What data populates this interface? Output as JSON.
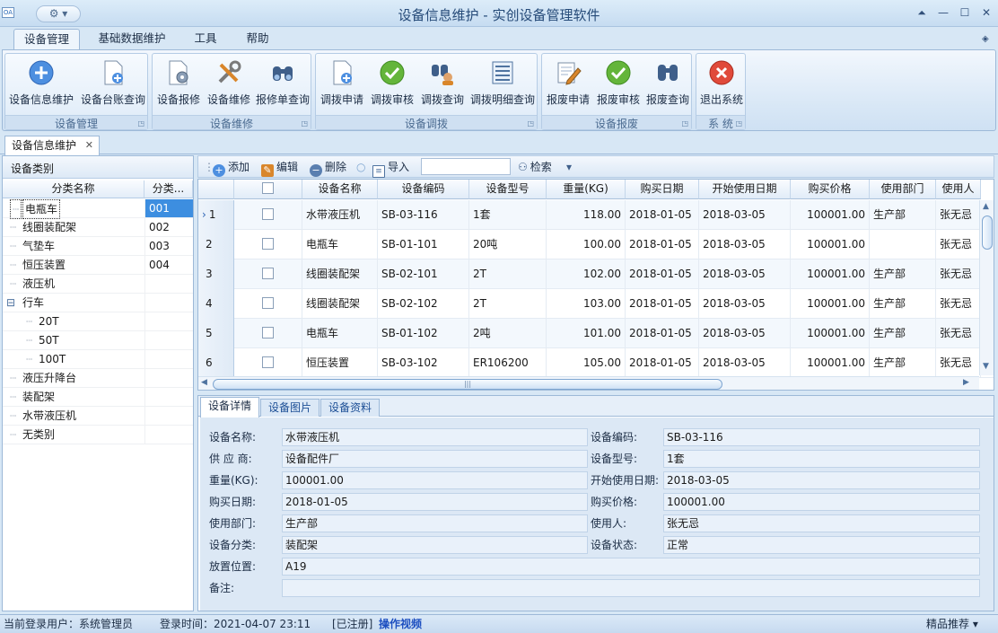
{
  "window": {
    "title": "设备信息维护 - 实创设备管理软件",
    "app_icon_text": "OA"
  },
  "ribbon_tabs": [
    "设备管理",
    "基础数据维护",
    "工具",
    "帮助"
  ],
  "ribbon_groups": [
    {
      "label": "设备管理",
      "buttons": [
        "设备信息维护",
        "设备台账查询"
      ]
    },
    {
      "label": "设备维修",
      "buttons": [
        "设备报修",
        "设备维修",
        "报修单查询"
      ]
    },
    {
      "label": "设备调拨",
      "buttons": [
        "调拨申请",
        "调拨审核",
        "调拨查询",
        "调拨明细查询"
      ]
    },
    {
      "label": "设备报废",
      "buttons": [
        "报废申请",
        "报废审核",
        "报废查询"
      ]
    },
    {
      "label": "系 统",
      "buttons": [
        "退出系统"
      ]
    }
  ],
  "doc_tab": {
    "label": "设备信息维护",
    "close": "✕"
  },
  "left_panel": {
    "title": "设备类别",
    "columns": [
      "分类名称",
      "分类..."
    ],
    "rows": [
      {
        "name": "电瓶车",
        "code": "001",
        "level": 0
      },
      {
        "name": "线圈装配架",
        "code": "002",
        "level": 0
      },
      {
        "name": "气垫车",
        "code": "003",
        "level": 0
      },
      {
        "name": "恒压装置",
        "code": "004",
        "level": 0
      },
      {
        "name": "液压机",
        "code": "",
        "level": 0
      },
      {
        "name": "行车",
        "code": "",
        "level": 0,
        "expander": "⊟"
      },
      {
        "name": "20T",
        "code": "",
        "level": 1
      },
      {
        "name": "50T",
        "code": "",
        "level": 1
      },
      {
        "name": "100T",
        "code": "",
        "level": 1
      },
      {
        "name": "液压升降台",
        "code": "",
        "level": 0
      },
      {
        "name": "装配架",
        "code": "",
        "level": 0
      },
      {
        "name": "水带液压机",
        "code": "",
        "level": 0
      },
      {
        "name": "无类别",
        "code": "",
        "level": 0
      }
    ]
  },
  "toolbar": {
    "add": "添加",
    "edit": "编辑",
    "delete": "删除",
    "import": "导入",
    "search_value": "",
    "search": "检索"
  },
  "grid": {
    "columns": [
      "",
      "",
      "设备名称",
      "设备编码",
      "设备型号",
      "重量(KG)",
      "购买日期",
      "开始使用日期",
      "购买价格",
      "使用部门",
      "使用人"
    ],
    "rows": [
      {
        "n": "1",
        "name": "水带液压机",
        "code": "SB-03-116",
        "model": "1套",
        "weight": "118.00",
        "buy": "2018-01-05",
        "start": "2018-03-05",
        "price": "100001.00",
        "dept": "生产部",
        "user": "张无忌"
      },
      {
        "n": "2",
        "name": "电瓶车",
        "code": "SB-01-101",
        "model": "20吨",
        "weight": "100.00",
        "buy": "2018-01-05",
        "start": "2018-03-05",
        "price": "100001.00",
        "dept": "",
        "user": "张无忌"
      },
      {
        "n": "3",
        "name": "线圈装配架",
        "code": "SB-02-101",
        "model": "2T",
        "weight": "102.00",
        "buy": "2018-01-05",
        "start": "2018-03-05",
        "price": "100001.00",
        "dept": "生产部",
        "user": "张无忌"
      },
      {
        "n": "4",
        "name": "线圈装配架",
        "code": "SB-02-102",
        "model": "2T",
        "weight": "103.00",
        "buy": "2018-01-05",
        "start": "2018-03-05",
        "price": "100001.00",
        "dept": "生产部",
        "user": "张无忌"
      },
      {
        "n": "5",
        "name": "电瓶车",
        "code": "SB-01-102",
        "model": "2吨",
        "weight": "101.00",
        "buy": "2018-01-05",
        "start": "2018-03-05",
        "price": "100001.00",
        "dept": "生产部",
        "user": "张无忌"
      },
      {
        "n": "6",
        "name": "恒压装置",
        "code": "SB-03-102",
        "model": "ER106200",
        "weight": "105.00",
        "buy": "2018-01-05",
        "start": "2018-03-05",
        "price": "100001.00",
        "dept": "生产部",
        "user": "张无忌"
      }
    ]
  },
  "detail_tabs": [
    "设备详情",
    "设备图片",
    "设备资料"
  ],
  "detail": {
    "name_label": "设备名称:",
    "name": "水带液压机",
    "code_label": "设备编码:",
    "code": "SB-03-116",
    "supplier_label": "供 应 商:",
    "supplier": "设备配件厂",
    "model_label": "设备型号:",
    "model": "1套",
    "weight_label": "重量(KG):",
    "weight": "100001.00",
    "start_label": "开始使用日期:",
    "start": "2018-03-05",
    "buy_label": "购买日期:",
    "buy": "2018-01-05",
    "price_label": "购买价格:",
    "price": "100001.00",
    "dept_label": "使用部门:",
    "dept": "生产部",
    "user_label": "使用人:",
    "user": "张无忌",
    "category_label": "设备分类:",
    "category": "装配架",
    "status_label": "设备状态:",
    "status": "正常",
    "location_label": "放置位置:",
    "location": "A19",
    "note_label": "备注:",
    "note": ""
  },
  "status": {
    "user": "当前登录用户：系统管理员",
    "login_time": "登录时间：2021-04-07 23:11",
    "registered": "[已注册]",
    "video": "操作视频",
    "recommend": "精品推荐 ▾"
  }
}
